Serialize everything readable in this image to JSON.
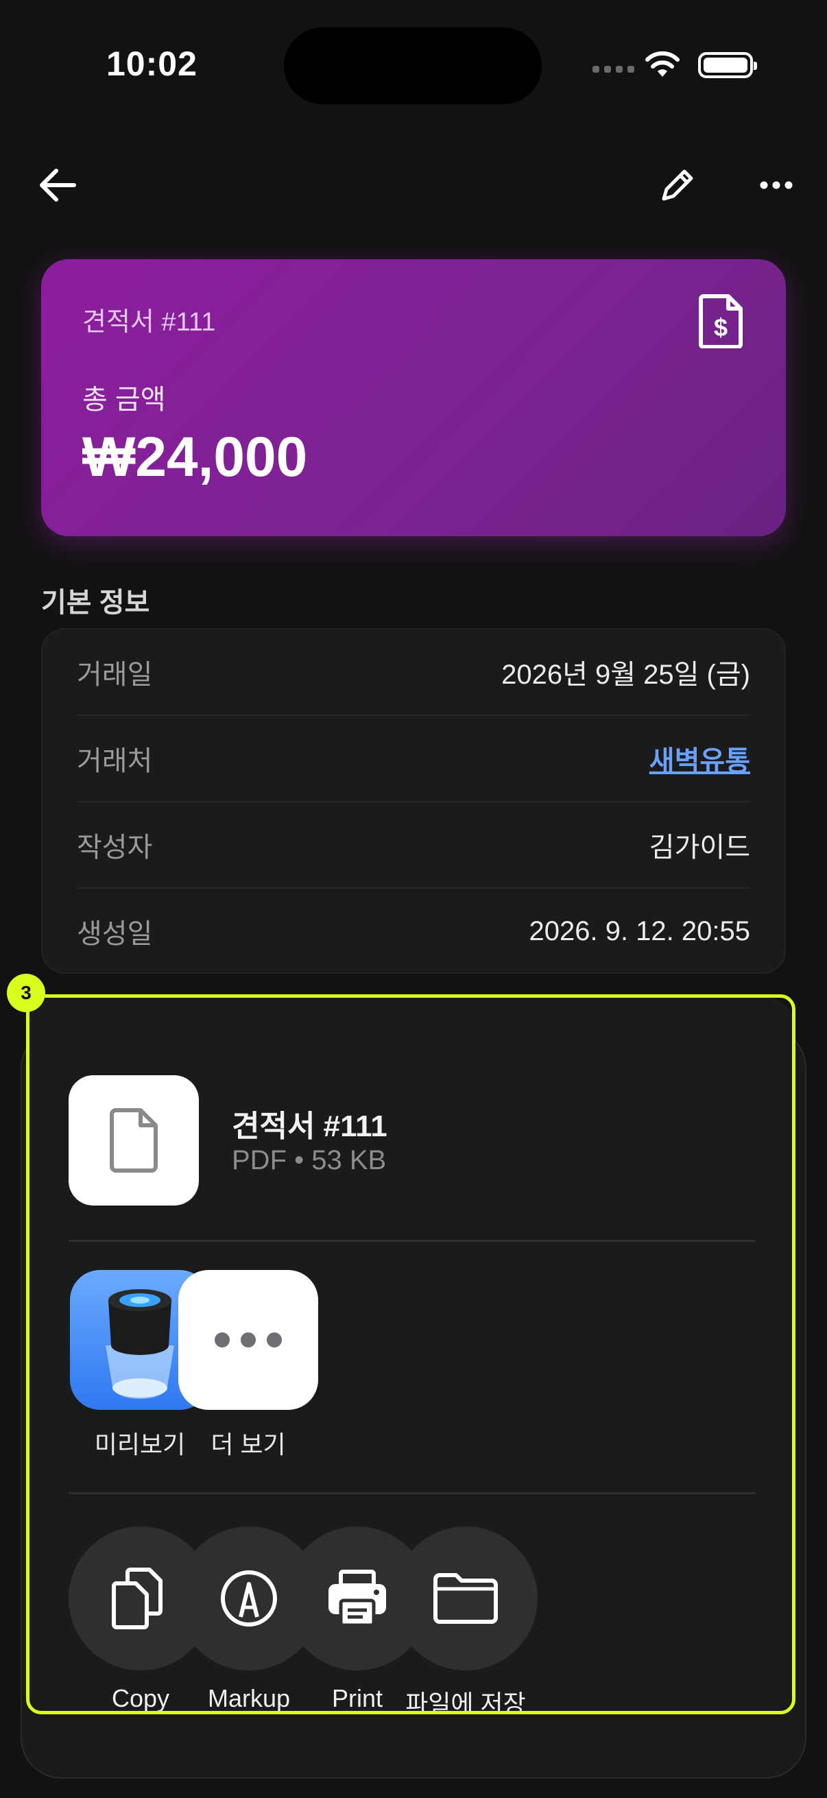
{
  "status_bar": {
    "time": "10:02"
  },
  "hero": {
    "doc_title": "견적서 #111",
    "total_label": "총 금액",
    "total_amount": "₩24,000",
    "accent_color": "#8d1d9e"
  },
  "basic_info": {
    "title": "기본 정보",
    "rows": [
      {
        "label": "거래일",
        "value": "2026년 9월 25일 (금)"
      },
      {
        "label": "거래처",
        "value": "새벽유통"
      },
      {
        "label": "작성자",
        "value": "김가이드"
      },
      {
        "label": "생성일",
        "value": "2026. 9. 12. 20:55"
      }
    ]
  },
  "share_sheet": {
    "badge": "3",
    "file_name": "견적서 #111",
    "file_meta": "PDF • 53 KB",
    "apps": [
      {
        "label": "미리보기",
        "icon": "preview-app-icon"
      },
      {
        "label": "더 보기",
        "icon": "more-apps-icon"
      }
    ],
    "actions": [
      {
        "label": "Copy",
        "icon": "copy-icon"
      },
      {
        "label": "Markup",
        "icon": "markup-icon"
      },
      {
        "label": "Print",
        "icon": "printer-icon"
      },
      {
        "label": "파일에 저장",
        "icon": "folder-icon"
      }
    ],
    "highlight_color": "#d8ff1e"
  }
}
